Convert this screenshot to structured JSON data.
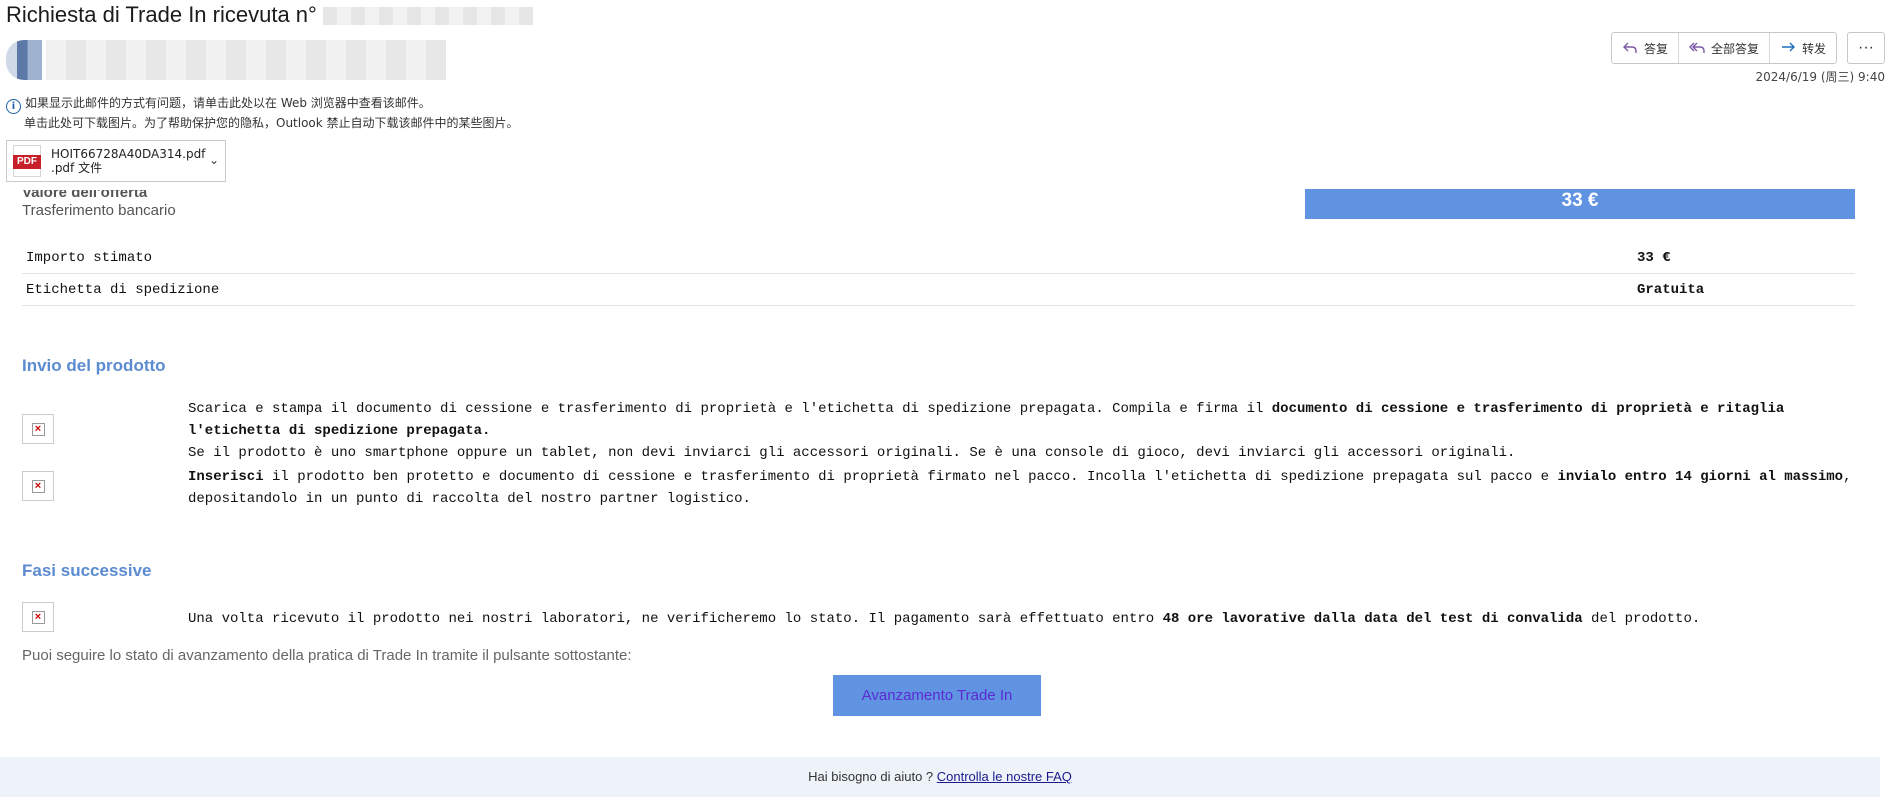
{
  "header": {
    "subject": "Richiesta di Trade In ricevuta n°",
    "date": "2024/6/19 (周三) 9:40"
  },
  "actions": {
    "reply": "答复",
    "reply_all": "全部答复",
    "forward": "转发",
    "more": "···"
  },
  "info": {
    "line1": "如果显示此邮件的方式有问题，请单击此处以在 Web 浏览器中查看该邮件。",
    "line2": "单击此处可下载图片。为了帮助保护您的隐私，Outlook 禁止自动下载该邮件中的某些图片。"
  },
  "attachment": {
    "icon_label": "PDF",
    "name": "HOIT66728A40DA314.pdf",
    "type": ".pdf 文件"
  },
  "offer": {
    "label": "Valore dell'offerta",
    "method": "Trasferimento bancario",
    "amount": "33 €"
  },
  "summary": [
    {
      "label": "Importo stimato",
      "value": "33 €"
    },
    {
      "label": "Etichetta di spedizione",
      "value": "Gratuita"
    }
  ],
  "invio": {
    "title": "Invio del prodotto",
    "p1_a": "Scarica e stampa il documento di cessione e trasferimento di proprietà e l'etichetta di spedizione prepagata. Compila e firma il ",
    "p1_b": "documento di cessione e trasferimento di proprietà e ritaglia l'etichetta di spedizione prepagata.",
    "p2": "Se il prodotto è uno smartphone oppure un tablet, non devi inviarci gli accessori originali. Se è una console di gioco, devi inviarci gli accessori originali.",
    "p3_a": "Inserisci",
    "p3_b": " il prodotto ben protetto e documento di cessione e trasferimento di proprietà firmato nel pacco. Incolla l'etichetta di spedizione prepagata sul pacco e ",
    "p3_c": "invialo entro 14 giorni al massimo",
    "p3_d": ", depositandolo in un punto di raccolta del nostro partner logistico."
  },
  "fasi": {
    "title": "Fasi successive",
    "p_a": "Una volta ricevuto il prodotto nei nostri laboratori, ne verificheremo lo stato. Il pagamento sarà effettuato entro ",
    "p_b": "48 ore lavorative dalla data del test di convalida",
    "p_c": " del prodotto.",
    "track": "Puoi seguire lo stato di avanzamento della pratica di Trade In tramite il pulsante sottostante:",
    "button": "Avanzamento Trade In"
  },
  "footer": {
    "text": "Hai bisogno di aiuto ? ",
    "link": "Controlla le nostre FAQ"
  },
  "colors": {
    "accent": "#6193e3",
    "section_title": "#5b8bd0",
    "footer_bg": "#eef3fa"
  }
}
